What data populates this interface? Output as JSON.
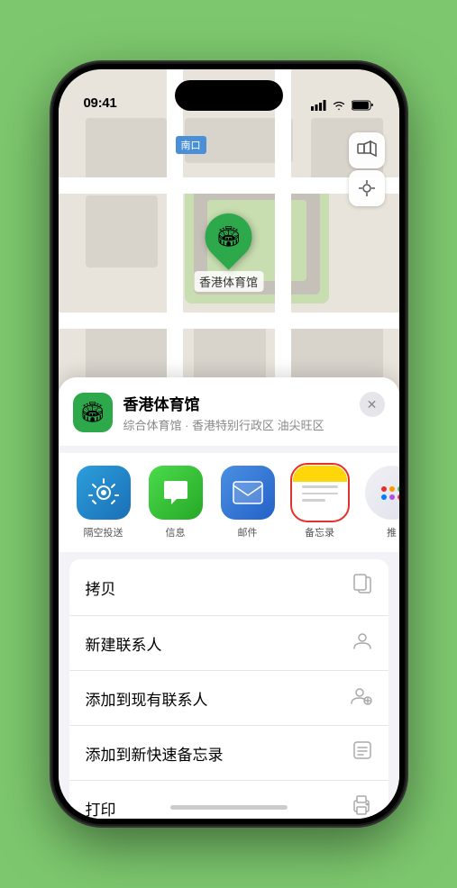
{
  "status_bar": {
    "time": "09:41",
    "location_icon": "▲"
  },
  "map": {
    "label": "南口",
    "marker_emoji": "🏟",
    "marker_name": "香港体育馆"
  },
  "location_header": {
    "icon_emoji": "🏟",
    "name": "香港体育馆",
    "subtitle": "综合体育馆 · 香港特别行政区 油尖旺区",
    "close_label": "✕"
  },
  "share_items": [
    {
      "id": "airdrop",
      "label": "隔空投送",
      "selected": false
    },
    {
      "id": "message",
      "label": "信息",
      "selected": false
    },
    {
      "id": "mail",
      "label": "邮件",
      "selected": false
    },
    {
      "id": "notes",
      "label": "备忘录",
      "selected": true
    },
    {
      "id": "more",
      "label": "推",
      "selected": false
    }
  ],
  "action_rows": [
    {
      "label": "拷贝",
      "icon": "📋"
    },
    {
      "label": "新建联系人",
      "icon": "👤"
    },
    {
      "label": "添加到现有联系人",
      "icon": "👤"
    },
    {
      "label": "添加到新快速备忘录",
      "icon": "📝"
    },
    {
      "label": "打印",
      "icon": "🖨"
    }
  ]
}
